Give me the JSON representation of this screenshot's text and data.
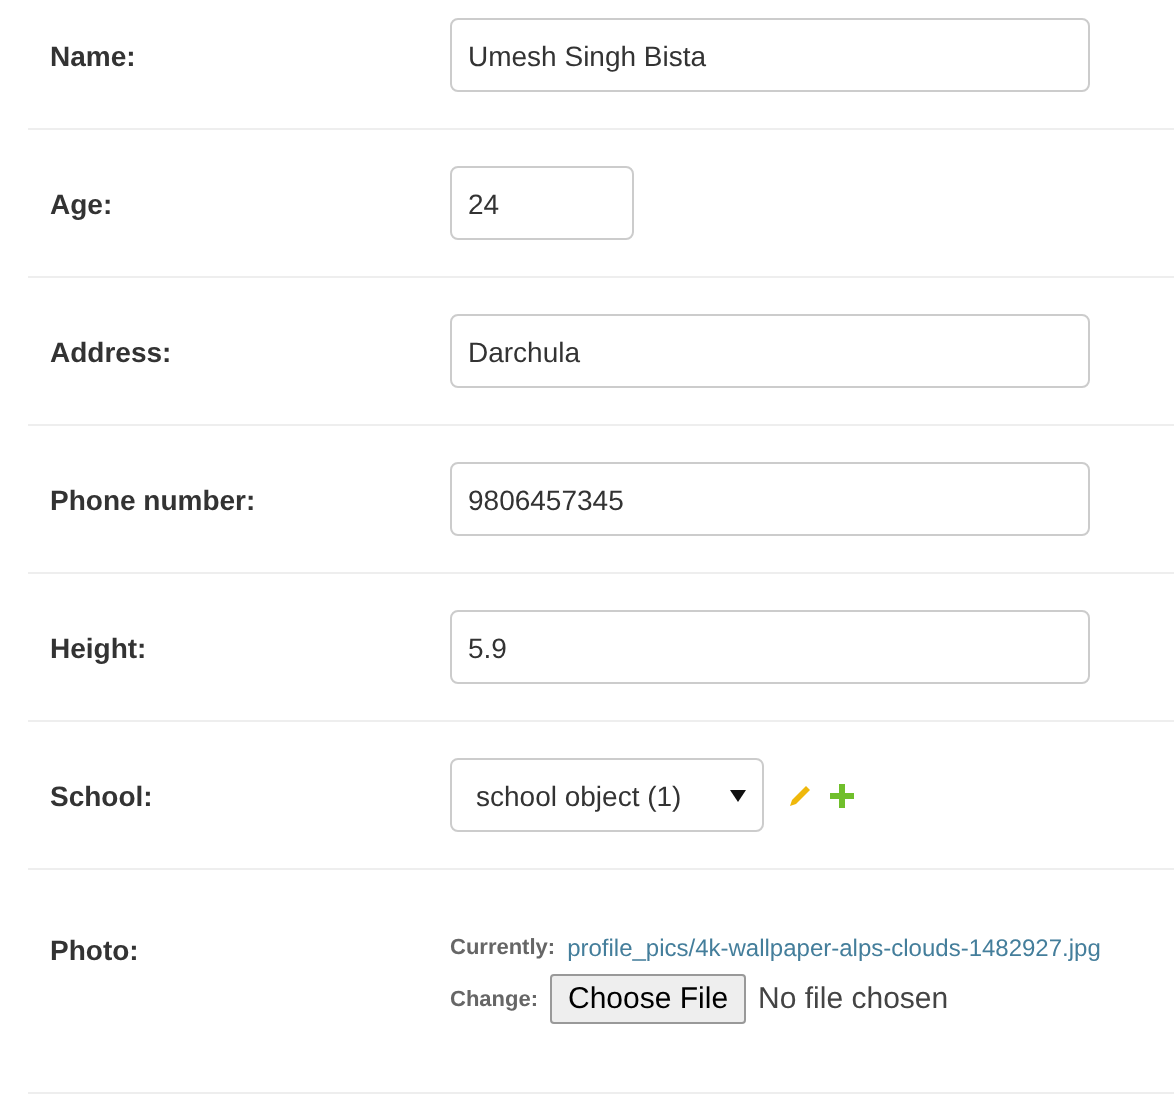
{
  "fields": [
    {
      "kind": "text",
      "label": "Name:",
      "value": "Umesh Singh Bista"
    },
    {
      "kind": "short_text",
      "label": "Age:",
      "value": "24"
    },
    {
      "kind": "text",
      "label": "Address:",
      "value": "Darchula"
    },
    {
      "kind": "text",
      "label": "Phone number:",
      "value": "9806457345"
    },
    {
      "kind": "text",
      "label": "Height:",
      "value": "5.9"
    },
    {
      "kind": "select",
      "label": "School:",
      "value": "school object (1)"
    },
    {
      "kind": "file",
      "label": "Photo:",
      "currently_label": "Currently:",
      "currently_link": "profile_pics/4k-wallpaper-alps-clouds-1482927.jpg",
      "change_label": "Change:",
      "button": "Choose File",
      "file_status": "No file chosen"
    }
  ]
}
